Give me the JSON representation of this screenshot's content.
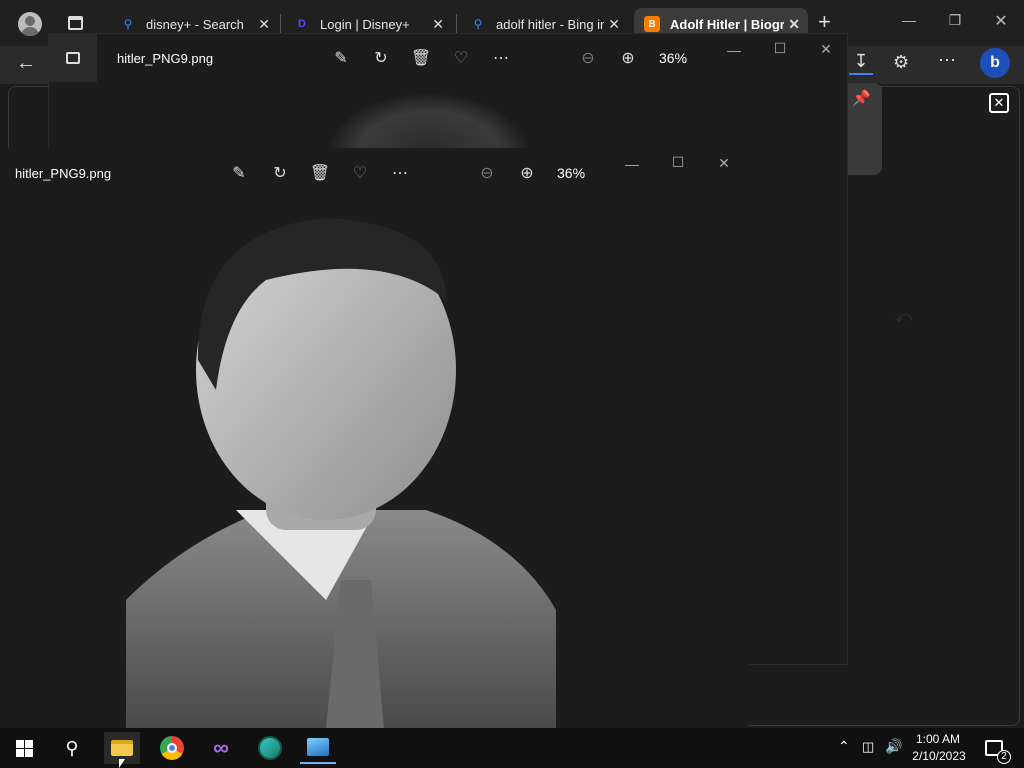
{
  "browser": {
    "tabs": [
      {
        "label": "disney+ - Search",
        "icon": "search-icon"
      },
      {
        "label": "Login | Disney+",
        "icon": "disney-icon"
      },
      {
        "label": "adolf hitler - Bing in",
        "icon": "search-icon"
      },
      {
        "label": "Adolf Hitler | Biogr",
        "icon": "blogger-icon",
        "active": true
      }
    ],
    "new_tab": "+"
  },
  "photos_back": {
    "filename": "hitler_PNG9.png",
    "zoom": "36%"
  },
  "photos_front": {
    "filename": "hitler_PNG9.png",
    "zoom": "36%"
  },
  "taskbar": {
    "time": "1:00 AM",
    "date": "2/10/2023",
    "notifications": "2"
  },
  "colors": {
    "accent_blue": "#3b82f6",
    "blogger_orange": "#f57d00",
    "bing_blue": "#2b7de9"
  }
}
